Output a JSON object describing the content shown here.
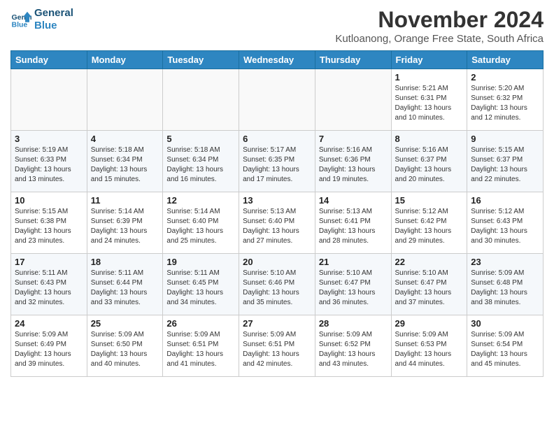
{
  "logo": {
    "line1": "General",
    "line2": "Blue"
  },
  "title": "November 2024",
  "subtitle": "Kutloanong, Orange Free State, South Africa",
  "weekdays": [
    "Sunday",
    "Monday",
    "Tuesday",
    "Wednesday",
    "Thursday",
    "Friday",
    "Saturday"
  ],
  "weeks": [
    [
      {
        "day": "",
        "info": ""
      },
      {
        "day": "",
        "info": ""
      },
      {
        "day": "",
        "info": ""
      },
      {
        "day": "",
        "info": ""
      },
      {
        "day": "",
        "info": ""
      },
      {
        "day": "1",
        "info": "Sunrise: 5:21 AM\nSunset: 6:31 PM\nDaylight: 13 hours\nand 10 minutes."
      },
      {
        "day": "2",
        "info": "Sunrise: 5:20 AM\nSunset: 6:32 PM\nDaylight: 13 hours\nand 12 minutes."
      }
    ],
    [
      {
        "day": "3",
        "info": "Sunrise: 5:19 AM\nSunset: 6:33 PM\nDaylight: 13 hours\nand 13 minutes."
      },
      {
        "day": "4",
        "info": "Sunrise: 5:18 AM\nSunset: 6:34 PM\nDaylight: 13 hours\nand 15 minutes."
      },
      {
        "day": "5",
        "info": "Sunrise: 5:18 AM\nSunset: 6:34 PM\nDaylight: 13 hours\nand 16 minutes."
      },
      {
        "day": "6",
        "info": "Sunrise: 5:17 AM\nSunset: 6:35 PM\nDaylight: 13 hours\nand 17 minutes."
      },
      {
        "day": "7",
        "info": "Sunrise: 5:16 AM\nSunset: 6:36 PM\nDaylight: 13 hours\nand 19 minutes."
      },
      {
        "day": "8",
        "info": "Sunrise: 5:16 AM\nSunset: 6:37 PM\nDaylight: 13 hours\nand 20 minutes."
      },
      {
        "day": "9",
        "info": "Sunrise: 5:15 AM\nSunset: 6:37 PM\nDaylight: 13 hours\nand 22 minutes."
      }
    ],
    [
      {
        "day": "10",
        "info": "Sunrise: 5:15 AM\nSunset: 6:38 PM\nDaylight: 13 hours\nand 23 minutes."
      },
      {
        "day": "11",
        "info": "Sunrise: 5:14 AM\nSunset: 6:39 PM\nDaylight: 13 hours\nand 24 minutes."
      },
      {
        "day": "12",
        "info": "Sunrise: 5:14 AM\nSunset: 6:40 PM\nDaylight: 13 hours\nand 25 minutes."
      },
      {
        "day": "13",
        "info": "Sunrise: 5:13 AM\nSunset: 6:40 PM\nDaylight: 13 hours\nand 27 minutes."
      },
      {
        "day": "14",
        "info": "Sunrise: 5:13 AM\nSunset: 6:41 PM\nDaylight: 13 hours\nand 28 minutes."
      },
      {
        "day": "15",
        "info": "Sunrise: 5:12 AM\nSunset: 6:42 PM\nDaylight: 13 hours\nand 29 minutes."
      },
      {
        "day": "16",
        "info": "Sunrise: 5:12 AM\nSunset: 6:43 PM\nDaylight: 13 hours\nand 30 minutes."
      }
    ],
    [
      {
        "day": "17",
        "info": "Sunrise: 5:11 AM\nSunset: 6:43 PM\nDaylight: 13 hours\nand 32 minutes."
      },
      {
        "day": "18",
        "info": "Sunrise: 5:11 AM\nSunset: 6:44 PM\nDaylight: 13 hours\nand 33 minutes."
      },
      {
        "day": "19",
        "info": "Sunrise: 5:11 AM\nSunset: 6:45 PM\nDaylight: 13 hours\nand 34 minutes."
      },
      {
        "day": "20",
        "info": "Sunrise: 5:10 AM\nSunset: 6:46 PM\nDaylight: 13 hours\nand 35 minutes."
      },
      {
        "day": "21",
        "info": "Sunrise: 5:10 AM\nSunset: 6:47 PM\nDaylight: 13 hours\nand 36 minutes."
      },
      {
        "day": "22",
        "info": "Sunrise: 5:10 AM\nSunset: 6:47 PM\nDaylight: 13 hours\nand 37 minutes."
      },
      {
        "day": "23",
        "info": "Sunrise: 5:09 AM\nSunset: 6:48 PM\nDaylight: 13 hours\nand 38 minutes."
      }
    ],
    [
      {
        "day": "24",
        "info": "Sunrise: 5:09 AM\nSunset: 6:49 PM\nDaylight: 13 hours\nand 39 minutes."
      },
      {
        "day": "25",
        "info": "Sunrise: 5:09 AM\nSunset: 6:50 PM\nDaylight: 13 hours\nand 40 minutes."
      },
      {
        "day": "26",
        "info": "Sunrise: 5:09 AM\nSunset: 6:51 PM\nDaylight: 13 hours\nand 41 minutes."
      },
      {
        "day": "27",
        "info": "Sunrise: 5:09 AM\nSunset: 6:51 PM\nDaylight: 13 hours\nand 42 minutes."
      },
      {
        "day": "28",
        "info": "Sunrise: 5:09 AM\nSunset: 6:52 PM\nDaylight: 13 hours\nand 43 minutes."
      },
      {
        "day": "29",
        "info": "Sunrise: 5:09 AM\nSunset: 6:53 PM\nDaylight: 13 hours\nand 44 minutes."
      },
      {
        "day": "30",
        "info": "Sunrise: 5:09 AM\nSunset: 6:54 PM\nDaylight: 13 hours\nand 45 minutes."
      }
    ]
  ]
}
